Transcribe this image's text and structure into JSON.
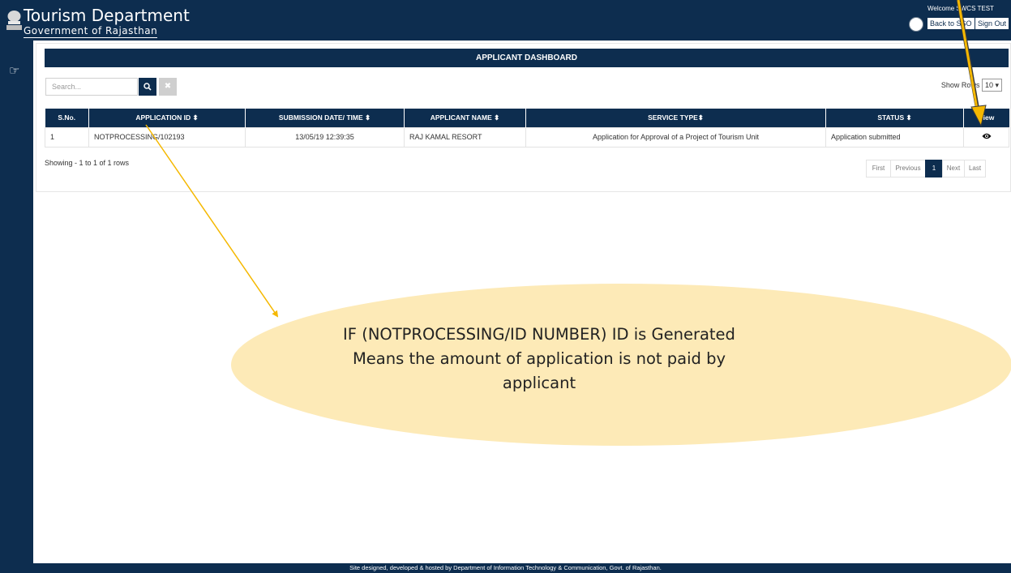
{
  "header": {
    "title": "Tourism Department",
    "subtitle": "Government of Rajasthan",
    "welcome": "Welcome SWCS TEST",
    "back_label": "Back to SSO",
    "signout_label": "Sign Out"
  },
  "dashboard": {
    "title": "APPLICANT DASHBOARD",
    "search_placeholder": "Search...",
    "show_rows_label": "Show Rows",
    "rows_value": "10 ▾",
    "columns": [
      "S.No.",
      "APPLICATION ID ⬍",
      "SUBMISSION DATE/ TIME ⬍",
      "APPLICANT NAME ⬍",
      "SERVICE TYPE⬍",
      "STATUS ⬍",
      "View"
    ],
    "rows": [
      {
        "sno": "1",
        "app_id": "NOTPROCESSING/102193",
        "date": "13/05/19 12:39:35",
        "name": "RAJ KAMAL RESORT",
        "service": "Application for Approval of a Project of Tourism Unit",
        "status": "Application submitted"
      }
    ],
    "showing": "Showing - 1 to 1 of 1 rows",
    "pager": {
      "first": "First",
      "previous": "Previous",
      "current": "1",
      "next": "Next",
      "last": "Last"
    }
  },
  "footer": "Site designed, developed & hosted by Department of Information Technology & Communication, Govt. of Rajasthan.",
  "annotation": {
    "line1": "IF (NOTPROCESSING/ID NUMBER) ID is Generated",
    "line2": "Means the amount of application is not paid by",
    "line3": "applicant"
  },
  "colors": {
    "navy": "#0d2d4f",
    "callout": "#fdeab7",
    "arrow": "#f5b800"
  }
}
